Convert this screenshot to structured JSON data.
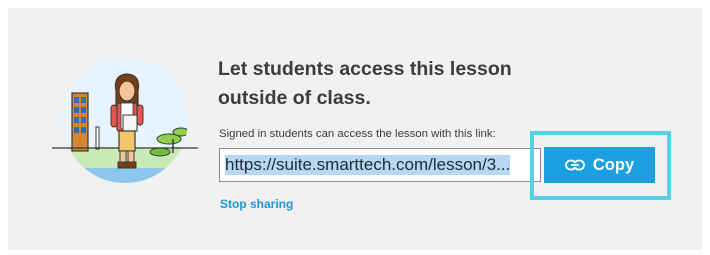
{
  "share": {
    "heading": "Let students access this lesson outside of class.",
    "hint": "Signed in students can access the lesson with this link:",
    "link_value": "https://suite.smarttech.com/lesson/3...",
    "copy_label": "Copy",
    "copy_icon": "link-icon",
    "stop_label": "Stop sharing"
  },
  "illustration": {
    "name": "student-with-tablet-illustration"
  },
  "colors": {
    "panel_background": "#f1f1f1",
    "accent": "#1aa0e0",
    "focus_highlight": "#58cfe3",
    "selection": "#b7d8f4"
  }
}
